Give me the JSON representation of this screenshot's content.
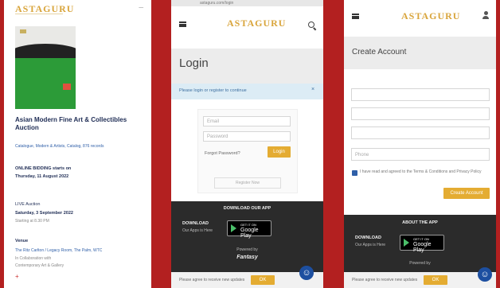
{
  "brand": "ASTAGURU",
  "panel1": {
    "auction_title": "Asian Modern Fine Art & Collectibles Auction",
    "meta_link": "Catalogue, Modern & Artists, Catalog, 876 records",
    "online_bid_label": "ONLINE BIDDING starts on",
    "online_bid_date": "Thursday, 11 August 2022",
    "live_label": "LIVE Auction",
    "live_date": "Saturday, 3 September 2022",
    "live_time": "Starting at 8.30 PM",
    "venue_label": "Venue",
    "venue_lines": [
      "The Ritz Carlton / Legacy Room, The Palm, WTC",
      "In Collaboration with",
      "Contemporary Art & Gallery"
    ],
    "more": "+"
  },
  "panel2": {
    "browser_url": "astaguru.com/login",
    "page_title": "Login",
    "notice": "Please login or register to continue",
    "email_placeholder": "Email",
    "password_placeholder": "Password",
    "forgot": "Forgot Password?",
    "login_btn": "Login",
    "register_btn": "Register Now",
    "footer_heading": "DOWNLOAD OUR APP",
    "download_label": "DOWNLOAD",
    "app_subtext": "Our Apps is Here",
    "gp_small": "GET IT ON",
    "gp_big": "Google Play",
    "powered": "Powered by",
    "powered_brand": "Fantasy",
    "bottom_text": "Please agree to receive new updates",
    "bottom_btn": "OK"
  },
  "panel3": {
    "page_title": "Create Account",
    "field_placeholders": [
      "",
      "",
      "",
      "Phone"
    ],
    "terms_text": "I have read and agreed to the Terms & Conditions and Privacy Policy",
    "submit_btn": "Create Account",
    "footer_heading": "ABOUT THE APP",
    "download_label": "DOWNLOAD",
    "app_subtext": "Our Apps is Here",
    "gp_small": "GET IT ON",
    "gp_big": "Google Play",
    "powered": "Powered by",
    "bottom_text": "Please agree to receive new updates",
    "bottom_btn": "OK"
  },
  "colors": {
    "frame": "#b32020",
    "gold": "#e4ac32",
    "footer": "#2b2b2b"
  }
}
